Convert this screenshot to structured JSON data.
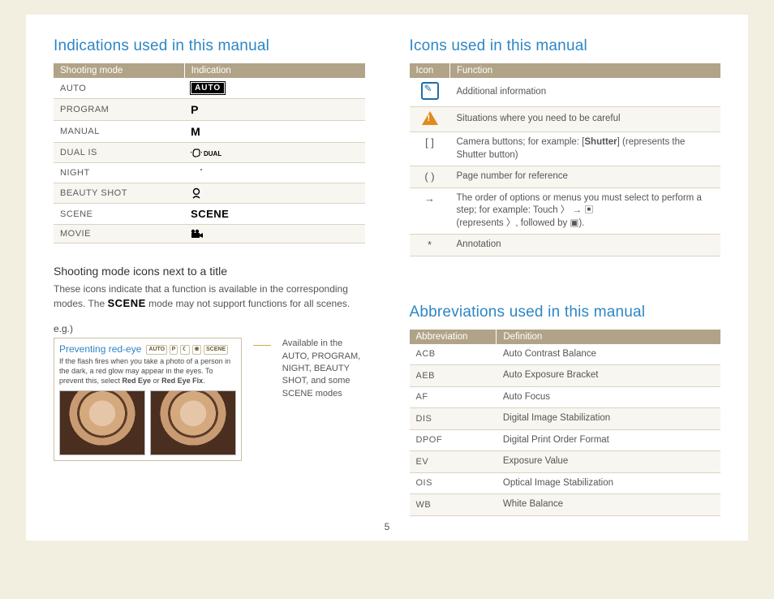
{
  "page_number": "5",
  "left": {
    "section_title": "Indications used in this manual",
    "table": {
      "headers": [
        "Shooting mode",
        "Indication"
      ],
      "rows": [
        {
          "mode": "AUTO",
          "indication": "AUTO"
        },
        {
          "mode": "PROGRAM",
          "indication": "P"
        },
        {
          "mode": "MANUAL",
          "indication": "M"
        },
        {
          "mode": "DUAL IS",
          "indication": "DUAL"
        },
        {
          "mode": "NIGHT",
          "indication": "night-icon"
        },
        {
          "mode": "BEAUTY SHOT",
          "indication": "beauty-icon"
        },
        {
          "mode": "SCENE",
          "indication": "SCENE"
        },
        {
          "mode": "MOVIE",
          "indication": "movie-icon"
        }
      ]
    },
    "sub_heading": "Shooting mode icons next to a title",
    "sub_body_prefix": "These icons indicate that a function is available in the corresponding modes. The ",
    "sub_body_scene": "SCENE",
    "sub_body_suffix": " mode may not support functions for all scenes.",
    "eg_label": "e.g.)",
    "example": {
      "title": "Preventing red-eye",
      "badges": [
        "AUTO",
        "P",
        "☾",
        "❀",
        "SCENE"
      ],
      "body_prefix": "If the flash fires when you take a photo of a person in the dark, a red glow may appear in the eyes. To prevent this, select ",
      "body_bold1": "Red Eye",
      "body_mid": " or ",
      "body_bold2": "Red Eye Fix",
      "body_suffix": "."
    },
    "caption": "Available in the AUTO, PROGRAM, NIGHT, BEAUTY SHOT, and some SCENE modes"
  },
  "right": {
    "icons_title": "Icons used in this manual",
    "icons_table": {
      "headers": [
        "Icon",
        "Function"
      ],
      "rows": [
        {
          "icon": "note",
          "text": "Additional information"
        },
        {
          "icon": "warn",
          "text": "Situations where you need to be careful"
        },
        {
          "icon": "[  ]",
          "text_prefix": "Camera buttons; for example: [",
          "text_bold": "Shutter",
          "text_suffix": "] (represents the Shutter button)"
        },
        {
          "icon": "(  )",
          "text": "Page number for reference"
        },
        {
          "icon": "→",
          "text_prefix": "The order of options or menus you must select to perform a step; for example: Touch ",
          "text_seq": "〉 → ▣",
          "text_suffix2": " (represents 〉, followed by ▣)."
        },
        {
          "icon": "*",
          "text": "Annotation"
        }
      ]
    },
    "abbrev_title": "Abbreviations used in this manual",
    "abbrev_table": {
      "headers": [
        "Abbreviation",
        "Definition"
      ],
      "rows": [
        {
          "abbr": "ACB",
          "def": "Auto Contrast Balance"
        },
        {
          "abbr": "AEB",
          "def": "Auto Exposure Bracket"
        },
        {
          "abbr": "AF",
          "def": "Auto Focus"
        },
        {
          "abbr": "DIS",
          "def": "Digital Image Stabilization"
        },
        {
          "abbr": "DPOF",
          "def": "Digital Print Order Format"
        },
        {
          "abbr": "EV",
          "def": "Exposure Value"
        },
        {
          "abbr": "OIS",
          "def": "Optical Image Stabilization"
        },
        {
          "abbr": "WB",
          "def": "White Balance"
        }
      ]
    }
  }
}
